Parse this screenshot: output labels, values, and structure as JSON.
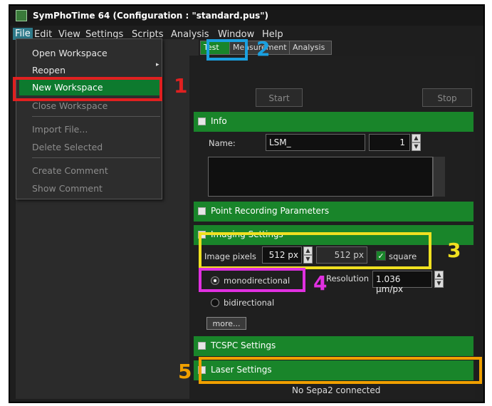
{
  "window": {
    "title": "SymPhoTime 64  (Configuration : \"standard.pus\")"
  },
  "menubar": {
    "items": [
      "File",
      "Edit",
      "View",
      "Settings",
      "Scripts",
      "Analysis",
      "Window",
      "Help"
    ]
  },
  "file_menu": {
    "items": [
      {
        "label": "Open Workspace",
        "enabled": true
      },
      {
        "label": "Reopen",
        "enabled": true,
        "submenu_arrow": "▸"
      },
      {
        "label": "New Workspace",
        "enabled": true,
        "highlighted": true
      },
      {
        "label": "Close Workspace",
        "enabled": false
      },
      {
        "label": "Import File...",
        "enabled": false
      },
      {
        "label": "Delete Selected",
        "enabled": false
      },
      {
        "label": "Create Comment",
        "enabled": false
      },
      {
        "label": "Show Comment",
        "enabled": false
      }
    ]
  },
  "tabs": [
    "Test",
    "Measurement",
    "Analysis"
  ],
  "active_tab": "Test",
  "controls": {
    "start_label": "Start",
    "stop_label": "Stop"
  },
  "info": {
    "header": "Info",
    "name_label": "Name:",
    "name_value": "LSM_",
    "counter_value": "1"
  },
  "sections": {
    "point_recording": "Point Recording Parameters",
    "imaging": "Imaging Settings",
    "tcspc": "TCSPC Settings",
    "laser": "Laser Settings"
  },
  "imaging": {
    "pixels_label": "Image pixels",
    "pixels_x": "512 px",
    "pixels_y": "512 px",
    "square_label": "square",
    "square_checked": true,
    "mono_label": "monodirectional",
    "bi_label": "bidirectional",
    "resolution_label": "Resolution",
    "resolution_value": "1.036 µm/px",
    "more_label": "more..."
  },
  "laser_status": "No Sepa2 connected",
  "annotations": [
    {
      "label": "1",
      "color": "#e02020"
    },
    {
      "label": "2",
      "color": "#1aa0e0"
    },
    {
      "label": "3",
      "color": "#f0e020"
    },
    {
      "label": "4",
      "color": "#e030e0"
    },
    {
      "label": "5",
      "color": "#f0a000"
    }
  ],
  "colors": {
    "accent_green": "#19852a",
    "menu_highlight": "#0d7a2e",
    "background_dark": "#1e1e1e"
  }
}
